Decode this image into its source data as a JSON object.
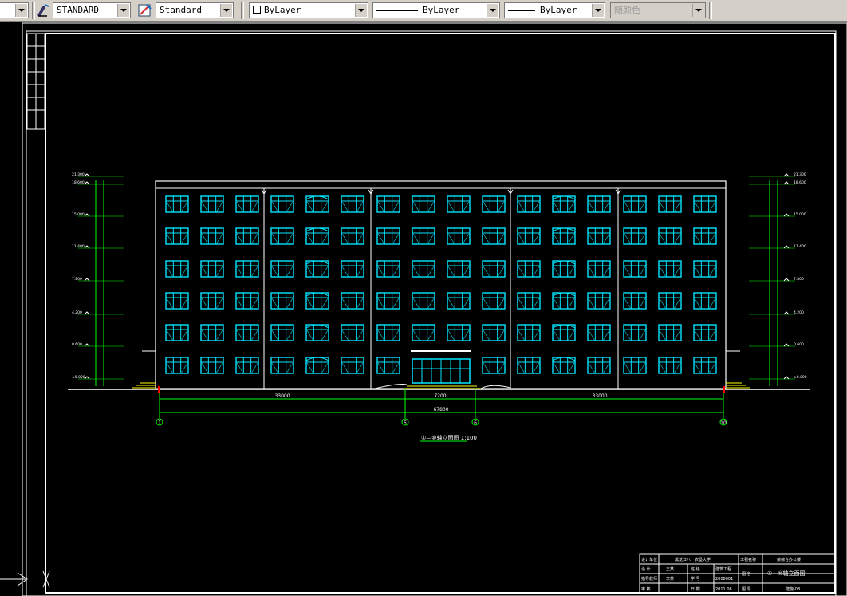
{
  "toolbar": {
    "text_style": "STANDARD",
    "dim_style": "Standard",
    "layer_color": "ByLayer",
    "linetype": "ByLayer",
    "lineweight": "ByLayer",
    "plot_style": "随颜色"
  },
  "drawing": {
    "title": "①—⑩轴立面图 1:100",
    "dims_bottom": [
      "33000",
      "7200",
      "33000"
    ],
    "dim_total": "67800",
    "axis_labels": [
      "1",
      "5",
      "6",
      "10"
    ],
    "elevations_left": [
      "21.300",
      "18.600",
      "15.000",
      "11.400",
      "7.800",
      "4.200",
      "0.600",
      "±0.000"
    ],
    "elevations_right": [
      "21.300",
      "18.600",
      "15.000",
      "11.400",
      "7.800",
      "4.200",
      "0.600",
      "±0.000"
    ],
    "title_block": {
      "row1": [
        "设计单位",
        "黑龙江八一农垦大学",
        "工程名称",
        "某综合办公楼"
      ],
      "row2": [
        "设 计",
        "王某",
        "班 级",
        "建筑工程",
        "图 名",
        "①—⑩轴立面图"
      ],
      "row3": [
        "指导教师",
        "李某",
        "学 号",
        "2008001"
      ],
      "row4": [
        "审 核",
        "",
        "日 期",
        "2011.06",
        "图 号",
        "建施-08"
      ]
    }
  },
  "colors": {
    "window": "#00e5ff",
    "dimension": "#00ff00",
    "line": "#ffffff",
    "marker": "#ff0000",
    "stairs": "#ffff00"
  }
}
